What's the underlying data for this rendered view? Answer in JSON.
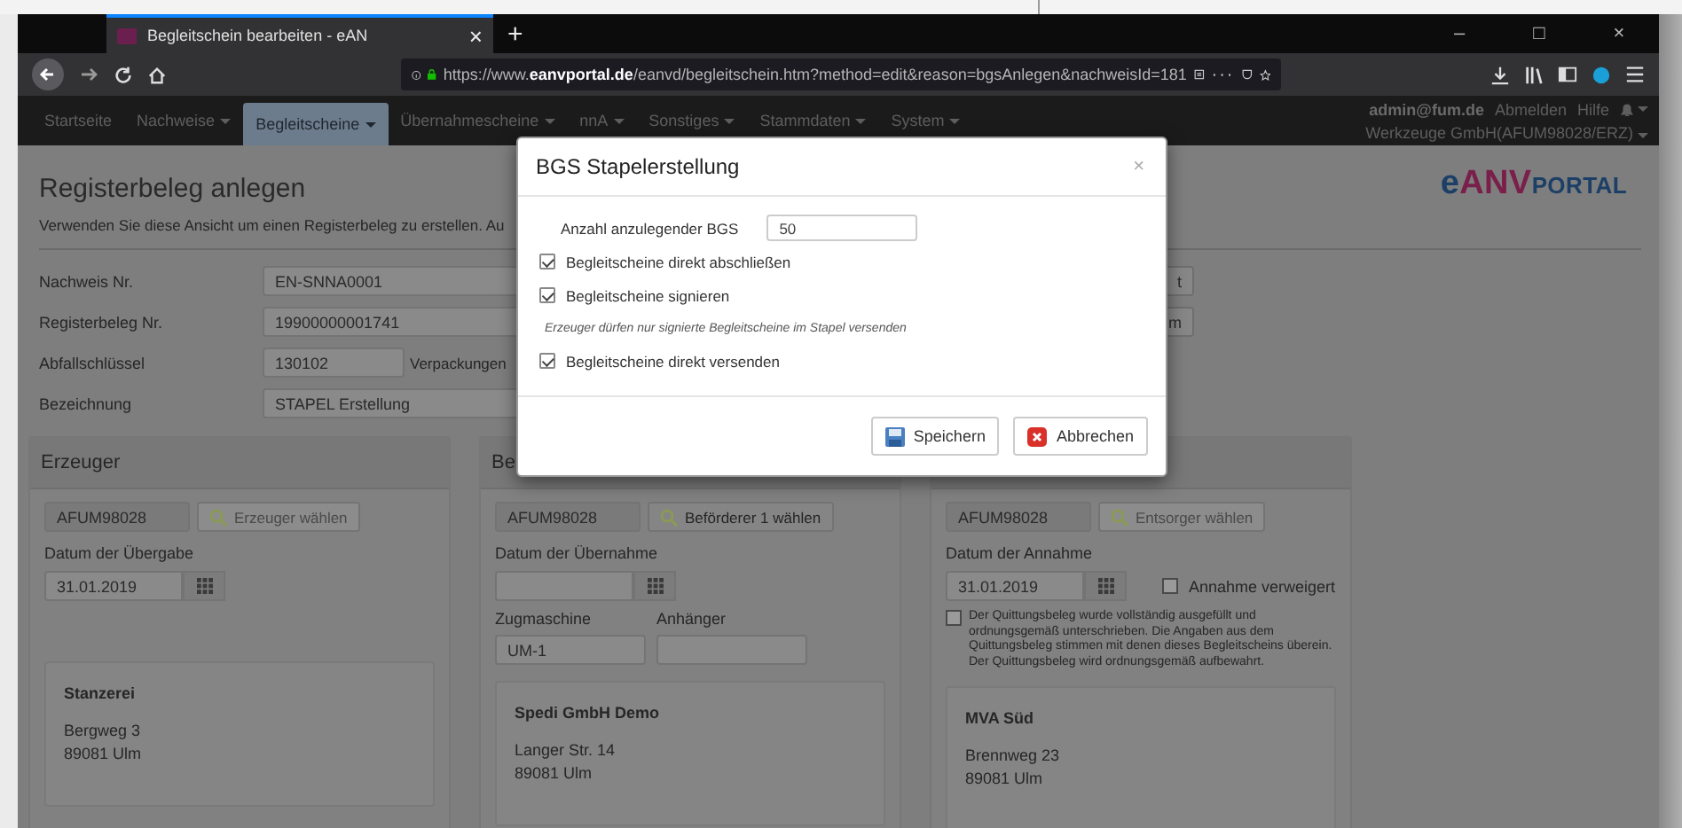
{
  "browser": {
    "tab": {
      "title": "Begleitschein bearbeiten - eAN",
      "close": "×"
    },
    "new_tab": "+",
    "window_controls": [
      "–",
      "□",
      "×"
    ],
    "url": "https://www.**eanvportal.de**/eanvd/begleitschein.htm?method=edit&reason=bgsAnlegen&nachweisId=181",
    "page_actions": "···"
  },
  "navbar": {
    "items": [
      {
        "label": "Startseite",
        "dropdown": false,
        "selected": false
      },
      {
        "label": "Nachweise",
        "dropdown": true,
        "selected": false
      },
      {
        "label": "Begleitscheine",
        "dropdown": true,
        "selected": true
      },
      {
        "label": "Übernahmescheine",
        "dropdown": true,
        "selected": false
      },
      {
        "label": "nnA",
        "dropdown": true,
        "selected": false
      },
      {
        "label": "Sonstiges",
        "dropdown": true,
        "selected": false
      },
      {
        "label": "Stammdaten",
        "dropdown": true,
        "selected": false
      },
      {
        "label": "System",
        "dropdown": true,
        "selected": false
      }
    ],
    "user": "admin@fum.de",
    "logout": "Abmelden",
    "help": "Hilfe",
    "company": "Werkzeuge GmbH(AFUM98028/ERZ)"
  },
  "page": {
    "title": "Registerbeleg anlegen",
    "intro": "Verwenden Sie diese Ansicht um einen Registerbeleg zu erstellen. Au",
    "logo": {
      "prefix": "e",
      "main": "ANV",
      "suffix": "PORTAL"
    },
    "fields": [
      {
        "label": "Nachweis Nr.",
        "value": "EN-SNNA0001",
        "button": "t"
      },
      {
        "label": "Registerbeleg Nr.",
        "value": "19900000001741",
        "button": "m"
      },
      {
        "label": "Abfallschlüssel",
        "value": "130102",
        "extra": "Verpackungen"
      },
      {
        "label": "Bezeichnung",
        "value": "STAPEL Erstellung"
      }
    ]
  },
  "panels": [
    {
      "title": "Erzeuger",
      "number": "AFUM98028",
      "choose_button": {
        "label": "Erzeuger wählen",
        "disabled": true
      },
      "date_label": "Datum der Übergabe",
      "date": "31.01.2019",
      "address": {
        "name": "Stanzerei",
        "lines": [
          "Bergweg 3",
          "89081 Ulm"
        ]
      }
    },
    {
      "title": "Be",
      "number": "AFUM98028",
      "choose_button": {
        "label": "Beförderer 1 wählen",
        "disabled": false
      },
      "date_label": "Datum der Übernahme",
      "vehicle": {
        "tractor_label": "Zugmaschine",
        "tractor": "UM-1",
        "trailer_label": "Anhänger"
      },
      "address": {
        "name": "Spedi GmbH Demo",
        "lines": [
          "Langer Str. 14",
          "89081 Ulm"
        ]
      }
    },
    {
      "number": "AFUM98028",
      "choose_button": {
        "label": "Entsorger wählen",
        "disabled": true
      },
      "date_label": "Datum der Annahme",
      "date": "31.01.2019",
      "refused": {
        "label": "Annahme verweigert",
        "checked": false
      },
      "receipt": {
        "label": "Der Quittungsbeleg wurde vollständig ausgefüllt und ordnungsgemäß unterschrieben. Die Angaben aus dem Quittungsbeleg stimmen mit denen dieses Begleitscheins überein. Der Quittungsbeleg wird ordnungsgemäß aufbewahrt.",
        "checked": false
      },
      "address": {
        "name": "MVA Süd",
        "lines": [
          "Brennweg 23",
          "89081 Ulm"
        ]
      }
    }
  ],
  "dialog": {
    "title": "BGS Stapelerstellung",
    "close": "×",
    "count_label": "Anzahl anzulegender BGS",
    "count": "50",
    "options": [
      {
        "kind": "checkbox",
        "label": "Begleitscheine direkt abschließen",
        "checked": true
      },
      {
        "kind": "checkbox",
        "label": "Begleitscheine signieren",
        "checked": true
      },
      {
        "kind": "hint",
        "label": "Erzeuger dürfen nur signierte Begleitscheine im Stapel versenden"
      },
      {
        "kind": "checkbox",
        "label": "Begleitscheine direkt versenden",
        "checked": true
      }
    ],
    "save": "Speichern",
    "cancel": "Abbrechen"
  }
}
